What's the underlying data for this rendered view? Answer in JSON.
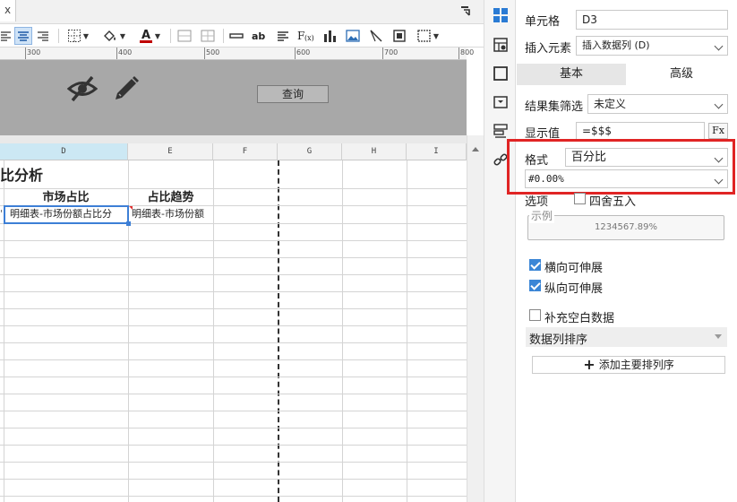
{
  "tab_close_glyph": "x",
  "ruler_marks": [
    "300",
    "400",
    "500",
    "600",
    "700",
    "800"
  ],
  "param_zone": {
    "query_label": "查询"
  },
  "columns": [
    "D",
    "E",
    "F",
    "G",
    "H",
    "I"
  ],
  "report": {
    "title_fragment": "比分析",
    "header_d": "市场占比",
    "header_e": "占比趋势",
    "cell_d3": "明细表-市场份额占比分",
    "cell_e3": "明细表-市场份额",
    "left_fragment": "'"
  },
  "colors": {
    "selection": "#3d7fd6",
    "highlight_box": "#e02424",
    "active_column": "#cce8f4",
    "param_zone_bg": "#a8a8a8",
    "checkbox_on": "#3b86d6"
  },
  "toolbar_icons": [
    "align-left-icon",
    "align-center-icon",
    "align-right-icon",
    "border-icon",
    "fill-color-icon",
    "font-color-icon",
    "merge-icon",
    "split-icon",
    "strike-icon",
    "text-icon",
    "wrap-icon",
    "formula-icon",
    "bar-chart-icon",
    "image-icon",
    "slash-icon",
    "frame-icon",
    "widget-icon"
  ],
  "panel": {
    "cell_label": "单元格",
    "cell_value": "D3",
    "insert_label": "插入元素",
    "insert_value": "插入数据列 (D)",
    "tab_basic": "基本",
    "tab_advanced": "高级",
    "filter_label": "结果集筛选",
    "filter_value": "未定义",
    "display_label": "显示值",
    "display_value": "=$$$",
    "fx_label": "Fx",
    "format_label": "格式",
    "format_value": "百分比",
    "format_pattern": "#0.00%",
    "options_label": "选项",
    "rounding_label": "四舍五入",
    "rounding_checked": false,
    "example_label": "示例",
    "example_value": "1234567.89%",
    "h_expand_label": "横向可伸展",
    "h_expand_checked": true,
    "v_expand_label": "纵向可伸展",
    "v_expand_checked": true,
    "fill_blank_label": "补充空白数据",
    "fill_blank_checked": false,
    "sort_label": "数据列排序",
    "add_sort_label": "添加主要排列序"
  }
}
